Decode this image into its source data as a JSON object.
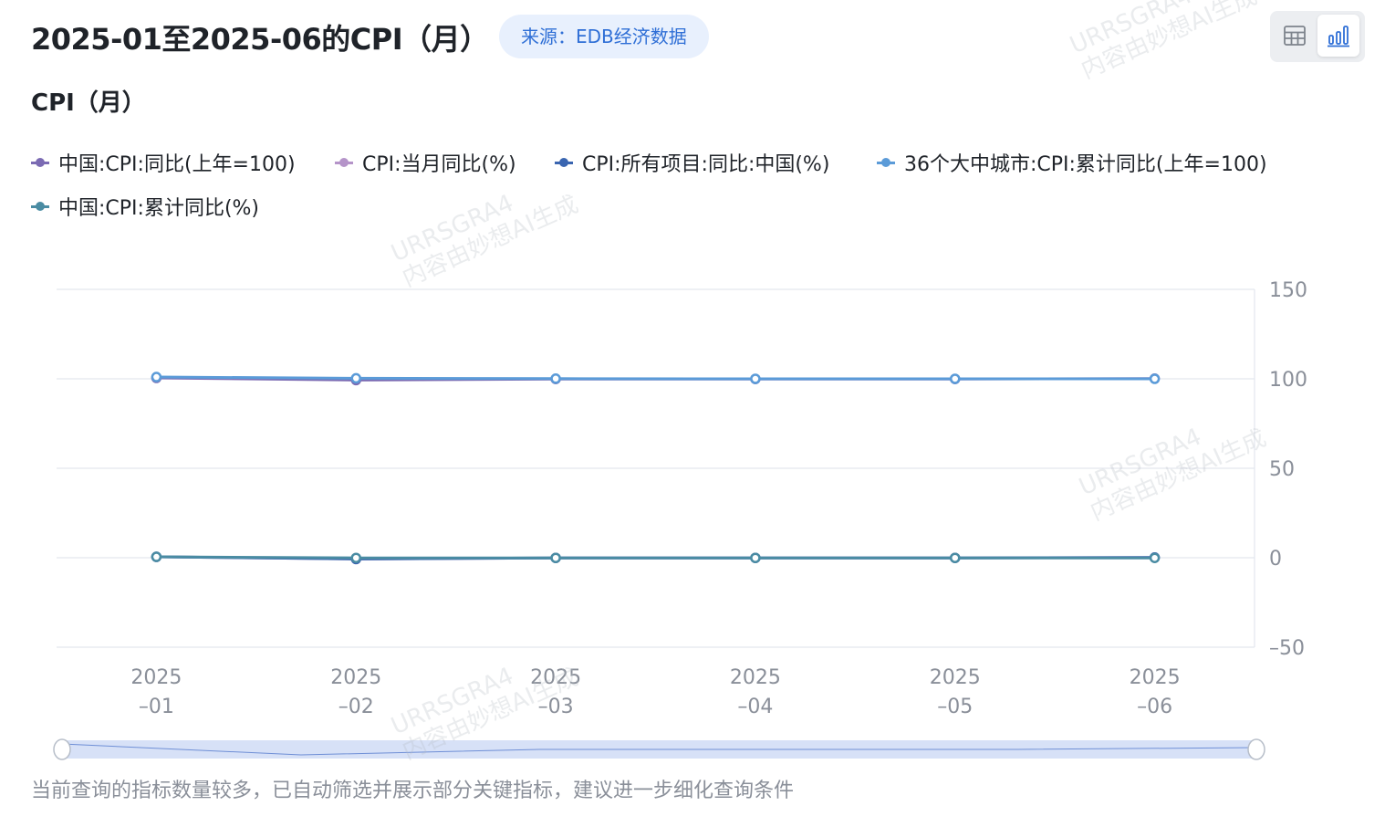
{
  "header": {
    "title": "2025-01至2025-06的CPI（月）",
    "source_badge": "来源：EDB经济数据"
  },
  "view_toggle": {
    "table_icon": "table-icon",
    "chart_icon": "bar-chart-icon",
    "active": "chart"
  },
  "chart_subtitle": "CPI（月）",
  "footer_note": "当前查询的指标数量较多，已自动筛选并展示部分关键指标，建议进一步细化查询条件",
  "watermark": {
    "line1": "URRSGRA4",
    "line2": "内容由妙想AI生成"
  },
  "colors": {
    "series1": "#7b6bb3",
    "series2": "#b594c9",
    "series3": "#3a65b0",
    "series4": "#5b9bd8",
    "series5": "#4a8ca3",
    "grid": "#e3e6ee",
    "axis_text": "#8a8f99",
    "slider_fill": "#d7e1f7"
  },
  "chart_data": {
    "type": "line",
    "title": "CPI（月）",
    "x": [
      "2025\n–01",
      "2025\n–02",
      "2025\n–03",
      "2025\n–04",
      "2025\n–05",
      "2025\n–06"
    ],
    "ylim": [
      -50,
      150
    ],
    "yticks": [
      "150",
      "100",
      "50",
      "0",
      "–50"
    ],
    "ytick_values": [
      150,
      100,
      50,
      0,
      -50
    ],
    "y_axis_position": "right",
    "grid": true,
    "legend_position": "top-left",
    "series": [
      {
        "name": "中国:CPI:同比(上年=100)",
        "values": [
          100.5,
          99.3,
          99.9,
          99.9,
          99.9,
          100.1
        ]
      },
      {
        "name": "CPI:当月同比(%)",
        "values": [
          0.5,
          -0.7,
          -0.1,
          -0.1,
          -0.1,
          0.1
        ]
      },
      {
        "name": "CPI:所有项目:同比:中国(%)",
        "values": [
          0.5,
          -0.7,
          -0.1,
          -0.1,
          -0.1,
          0.1
        ]
      },
      {
        "name": "36个大中城市:CPI:累计同比(上年=100)",
        "values": [
          101.0,
          100.3,
          100.1,
          100.0,
          100.0,
          100.0
        ]
      },
      {
        "name": "中国:CPI:累计同比(%)",
        "values": [
          0.5,
          -0.1,
          -0.1,
          -0.1,
          -0.1,
          -0.1
        ]
      }
    ]
  }
}
